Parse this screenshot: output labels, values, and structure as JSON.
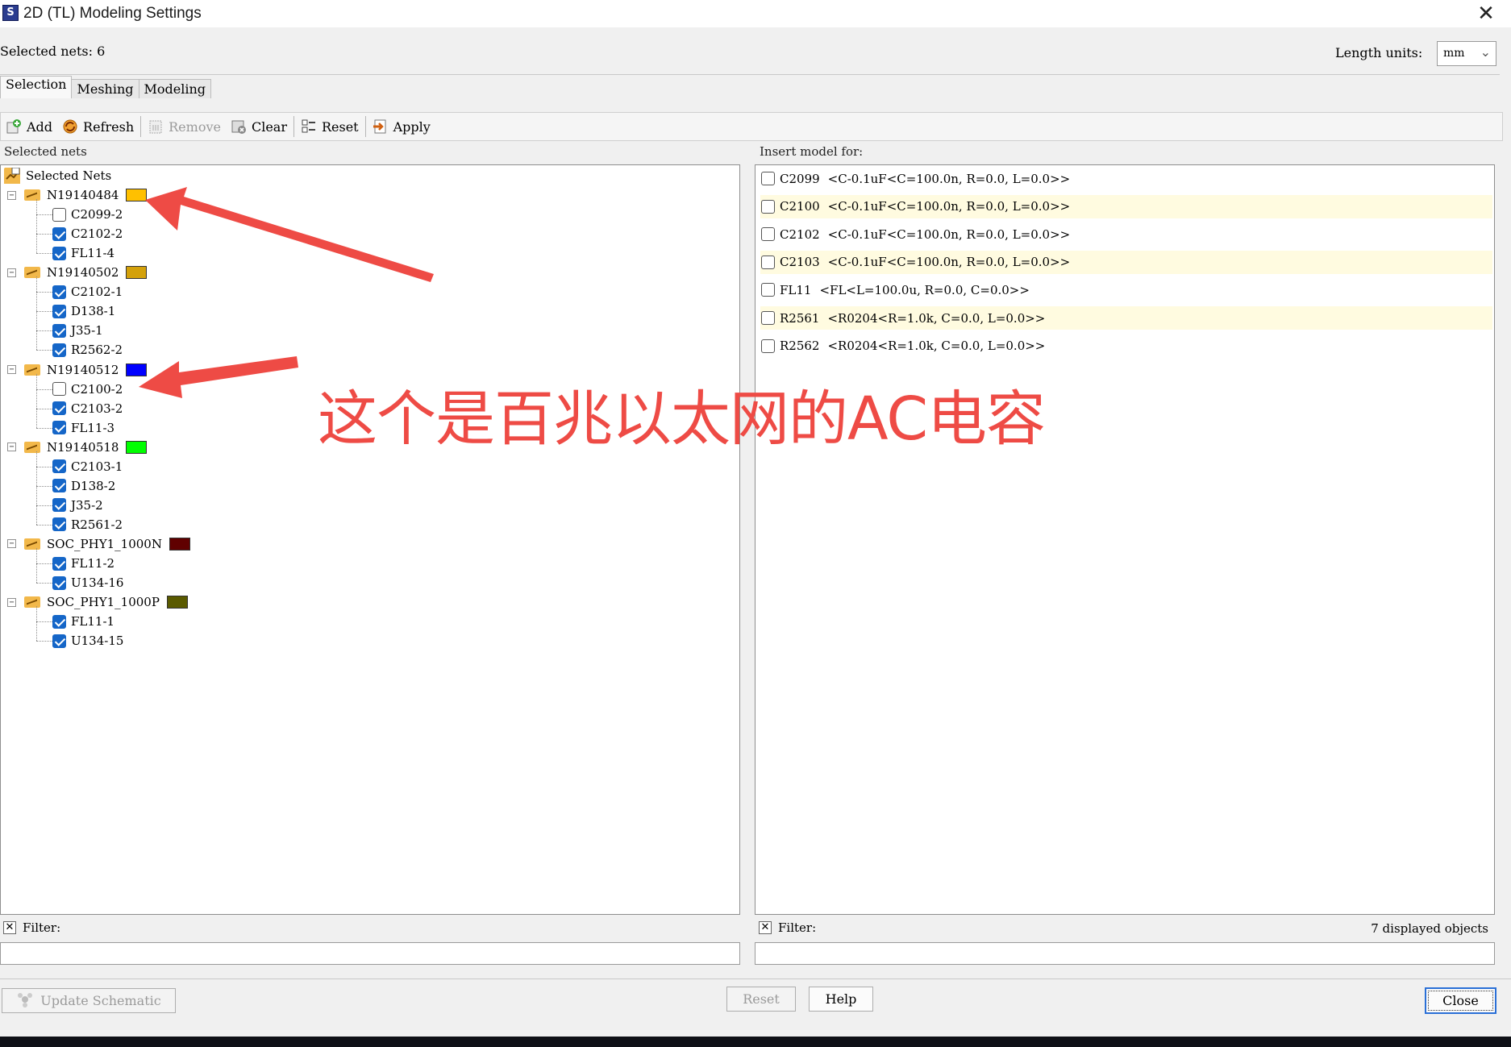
{
  "window": {
    "title": "2D (TL) Modeling Settings",
    "app_icon_glyph": "S"
  },
  "header": {
    "selected_nets_label": "Selected nets: 6",
    "length_units_label": "Length units:",
    "length_units_value": "mm"
  },
  "tabs": [
    "Selection",
    "Meshing",
    "Modeling"
  ],
  "toolbar": {
    "add": "Add",
    "refresh": "Refresh",
    "remove": "Remove",
    "clear": "Clear",
    "reset": "Reset",
    "apply": "Apply"
  },
  "left_panel": {
    "group_label": "Selected nets",
    "root_label": "Selected Nets",
    "nets": [
      {
        "name": "N19140484",
        "color": "#ffc000",
        "pins": [
          {
            "label": "C2099-2",
            "checked": false
          },
          {
            "label": "C2102-2",
            "checked": true
          },
          {
            "label": "FL11-4",
            "checked": true
          }
        ]
      },
      {
        "name": "N19140502",
        "color": "#d4a10a",
        "pins": [
          {
            "label": "C2102-1",
            "checked": true
          },
          {
            "label": "D138-1",
            "checked": true
          },
          {
            "label": "J35-1",
            "checked": true
          },
          {
            "label": "R2562-2",
            "checked": true
          }
        ]
      },
      {
        "name": "N19140512",
        "color": "#0000ff",
        "pins": [
          {
            "label": "C2100-2",
            "checked": false
          },
          {
            "label": "C2103-2",
            "checked": true
          },
          {
            "label": "FL11-3",
            "checked": true
          }
        ]
      },
      {
        "name": "N19140518",
        "color": "#00ff00",
        "pins": [
          {
            "label": "C2103-1",
            "checked": true
          },
          {
            "label": "D138-2",
            "checked": true
          },
          {
            "label": "J35-2",
            "checked": true
          },
          {
            "label": "R2561-2",
            "checked": true
          }
        ]
      },
      {
        "name": "SOC_PHY1_1000N",
        "color": "#600000",
        "pins": [
          {
            "label": "FL11-2",
            "checked": true
          },
          {
            "label": "U134-16",
            "checked": true
          }
        ]
      },
      {
        "name": "SOC_PHY1_1000P",
        "color": "#5a5a00",
        "pins": [
          {
            "label": "FL11-1",
            "checked": true
          },
          {
            "label": "U134-15",
            "checked": true
          }
        ]
      }
    ],
    "filter_label": "Filter:"
  },
  "right_panel": {
    "group_label": "Insert model for:",
    "models": [
      {
        "ref": "C2099",
        "model": "<C-0.1uF<C=100.0n, R=0.0, L=0.0>>",
        "checked": false
      },
      {
        "ref": "C2100",
        "model": "<C-0.1uF<C=100.0n, R=0.0, L=0.0>>",
        "checked": false
      },
      {
        "ref": "C2102",
        "model": "<C-0.1uF<C=100.0n, R=0.0, L=0.0>>",
        "checked": false
      },
      {
        "ref": "C2103",
        "model": "<C-0.1uF<C=100.0n, R=0.0, L=0.0>>",
        "checked": false
      },
      {
        "ref": "FL11",
        "model": "<FL<L=100.0u, R=0.0, C=0.0>>",
        "checked": false
      },
      {
        "ref": "R2561",
        "model": "<R0204<R=1.0k, C=0.0, L=0.0>>",
        "checked": false
      },
      {
        "ref": "R2562",
        "model": "<R0204<R=1.0k, C=0.0, L=0.0>>",
        "checked": false
      }
    ],
    "filter_label": "Filter:",
    "displayed_count": "7 displayed objects"
  },
  "footer": {
    "update_schematic": "Update Schematic",
    "reset": "Reset",
    "help": "Help",
    "close": "Close"
  },
  "annotation": {
    "text": "这个是百兆以太网的AC电容",
    "color": "#ee4b45"
  }
}
